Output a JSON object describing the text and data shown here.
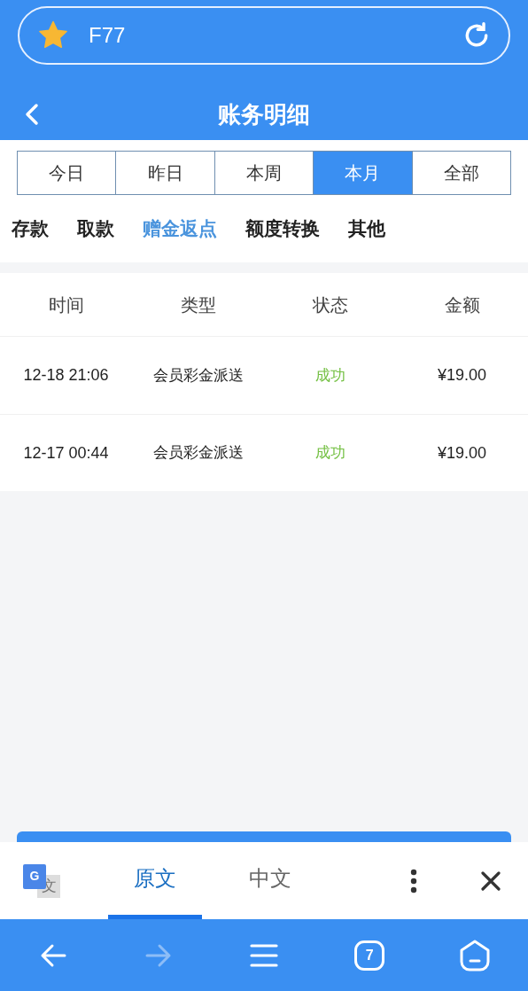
{
  "address_bar": {
    "url": "F77"
  },
  "header": {
    "title": "账务明细"
  },
  "periods": [
    {
      "label": "今日",
      "selected": false
    },
    {
      "label": "昨日",
      "selected": false
    },
    {
      "label": "本周",
      "selected": false
    },
    {
      "label": "本月",
      "selected": true
    },
    {
      "label": "全部",
      "selected": false
    }
  ],
  "categories": [
    {
      "label": "存款",
      "selected": false
    },
    {
      "label": "取款",
      "selected": false
    },
    {
      "label": "赠金返点",
      "selected": true
    },
    {
      "label": "额度转换",
      "selected": false
    },
    {
      "label": "其他",
      "selected": false
    }
  ],
  "table": {
    "columns": [
      "时间",
      "类型",
      "状态",
      "金额"
    ],
    "rows": [
      {
        "time": "12-18 21:06",
        "type": "会员彩金派送",
        "status": "成功",
        "amount": "¥19.00"
      },
      {
        "time": "12-17 00:44",
        "type": "会员彩金派送",
        "status": "成功",
        "amount": "¥19.00"
      }
    ]
  },
  "translate_bar": {
    "logo": {
      "letter": "G",
      "glyph": "文"
    },
    "tabs": [
      {
        "label": "原文",
        "selected": true
      },
      {
        "label": "中文",
        "selected": false
      }
    ]
  },
  "bottom_nav": {
    "forward_disabled": true,
    "tab_count": "7"
  }
}
